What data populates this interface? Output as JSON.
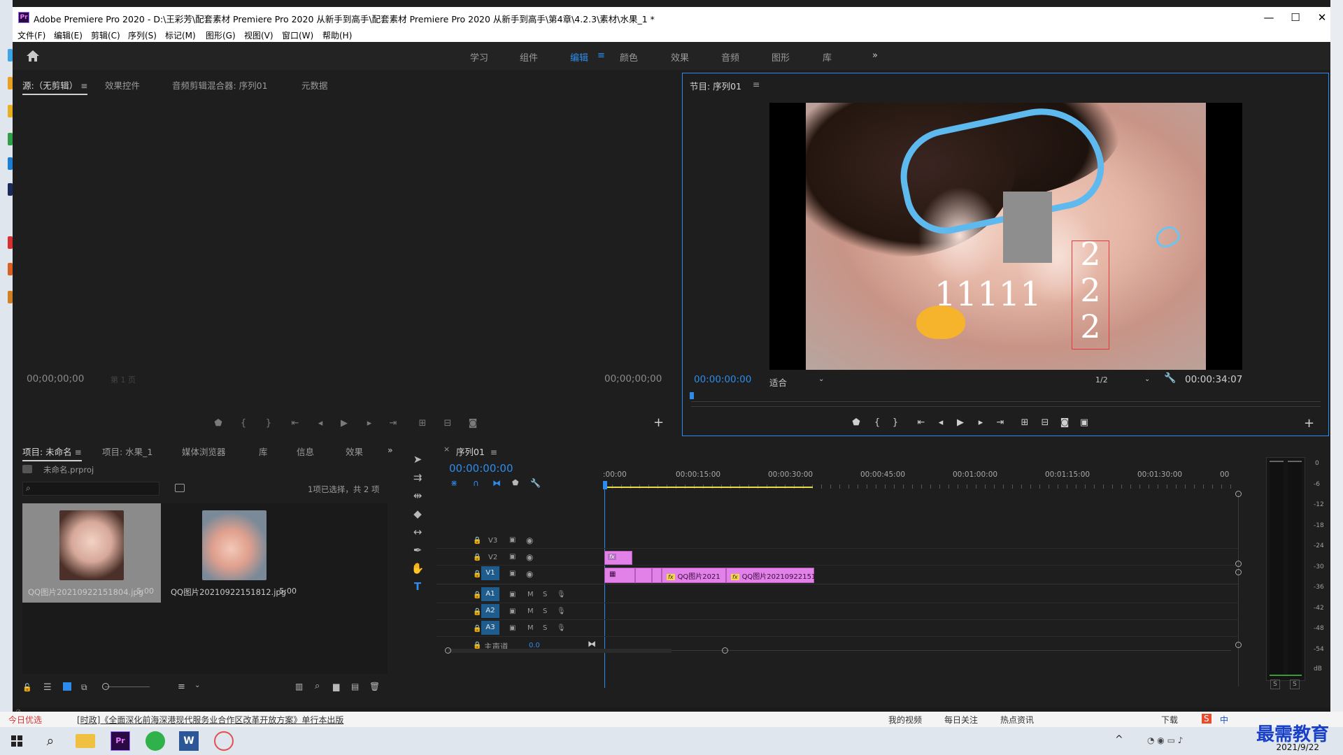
{
  "window": {
    "title": "Adobe Premiere Pro 2020 - D:\\王彩芳\\配套素材 Premiere Pro 2020 从新手到高手\\配套素材 Premiere Pro 2020 从新手到高手\\第4章\\4.2.3\\素材\\水果_1 *",
    "app_badge": "Pr",
    "controls": {
      "minimize": "—",
      "maximize": "☐",
      "close": "✕"
    }
  },
  "menubar": [
    "文件(F)",
    "编辑(E)",
    "剪辑(C)",
    "序列(S)",
    "标记(M)",
    "图形(G)",
    "视图(V)",
    "窗口(W)",
    "帮助(H)"
  ],
  "workspaces": {
    "tabs": [
      "学习",
      "组件",
      "编辑",
      "颜色",
      "效果",
      "音频",
      "图形",
      "库"
    ],
    "active": "编辑",
    "active_menu": "≡",
    "overflow": "»"
  },
  "source_panel": {
    "tabs": [
      "源:（无剪辑）",
      "效果控件",
      "音频剪辑混合器: 序列01",
      "元数据"
    ],
    "menu": "≡",
    "timecode_in": "00;00;00;00",
    "timecode_out": "00;00;00;00",
    "page_select": "第 1 页"
  },
  "program_panel": {
    "title": "节目: 序列01",
    "menu": "≡",
    "timecode": "00:00:00:00",
    "fit": "适合",
    "resolution": "1/2",
    "duration": "00:00:34:07",
    "overlay_text_h": "11111",
    "overlay_text_v": [
      "2",
      "2",
      "2"
    ]
  },
  "project_panel": {
    "tabs": [
      "项目: 未命名",
      "项目: 水果_1",
      "媒体浏览器",
      "库",
      "信息",
      "效果"
    ],
    "menu": "≡",
    "file": "未命名.prproj",
    "search_placeholder": "",
    "selection_info": "1项已选择，共 2 项",
    "items": [
      {
        "name": "QQ图片20210922151804.jpg",
        "duration": "5:00",
        "selected": true
      },
      {
        "name": "QQ图片20210922151812.jpg",
        "duration": "5:00",
        "selected": false
      }
    ]
  },
  "timeline": {
    "tab": "序列01",
    "menu": "≡",
    "close": "×",
    "timecode": "00:00:00:00",
    "ruler": [
      ":00:00",
      "00:00:15:00",
      "00:00:30:00",
      "00:00:45:00",
      "00:01:00:00",
      "00:01:15:00",
      "00:01:30:00",
      "00"
    ],
    "video_tracks": [
      "V3",
      "V2",
      "V1"
    ],
    "audio_tracks": [
      "A1",
      "A2",
      "A3"
    ],
    "master_label": "主声道",
    "master_value": "0.0",
    "clips": [
      {
        "track": "V2",
        "label": "fx"
      },
      {
        "track": "V1",
        "label": "fx"
      },
      {
        "track": "V1",
        "label": "QQ图片2021"
      },
      {
        "track": "V1",
        "label": "QQ图片20210922151"
      }
    ],
    "mute": "M",
    "solo": "S"
  },
  "meters": {
    "scale": [
      "0",
      "-6",
      "-12",
      "-18",
      "-24",
      "-30",
      "-36",
      "-42",
      "-48",
      "-54",
      "dB"
    ],
    "solo_buttons": [
      "S",
      "S"
    ]
  },
  "news_bar": {
    "left": "今日优选",
    "headline": "[时政]《全面深化前海深港现代服务业合作区改革开放方案》单行本出版",
    "items": [
      "我的视频",
      "每日关注",
      "热点资讯",
      "下载"
    ]
  },
  "taskbar": {
    "date": "2021/9/22",
    "watermark": "最需教育",
    "ime": "中"
  },
  "colors": {
    "accent": "#2d8ceb",
    "clip_pink": "#e281e8",
    "track_blue": "#1e5c8e",
    "playhead_blue": "#2d8ceb"
  }
}
